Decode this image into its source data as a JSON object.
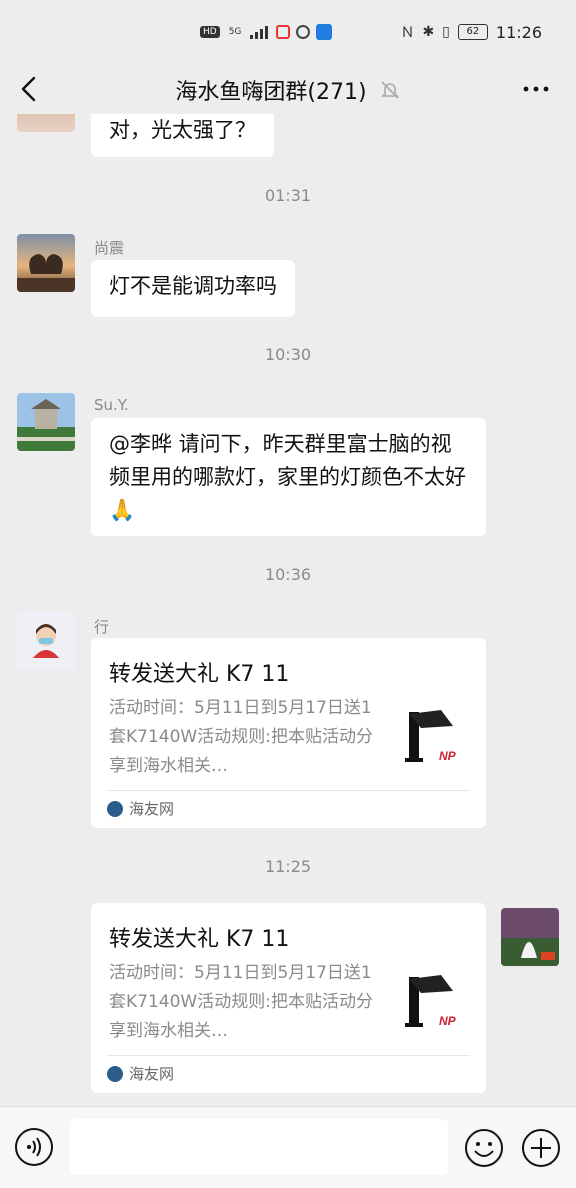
{
  "status_bar": {
    "left_chip": "HD",
    "network": "5G",
    "battery": "62",
    "time": "11:26",
    "icons": [
      "nfc-icon",
      "bluetooth-icon",
      "vibrate-icon"
    ]
  },
  "header": {
    "title": "海水鱼嗨团群(271)"
  },
  "messages": {
    "m0": {
      "text": "对，光太强了？"
    },
    "t1": "01:31",
    "m1": {
      "sender": "尚震",
      "text": "灯不是能调功率吗"
    },
    "t2": "10:30",
    "m2": {
      "sender": "Su.Y.",
      "text": "@李晔  请问下，昨天群里富士脑的视频里用的哪款灯，家里的灯颜色不太好🙏"
    },
    "t3": "10:36",
    "m3": {
      "sender": "行",
      "card": {
        "title": "转发送大礼 K7 11",
        "desc": "活动时间：5月11日到5月17日送1套K7140W活动规则:把本贴活动分享到海水相关…",
        "source": "海友网"
      }
    },
    "t4": "11:25",
    "m4": {
      "card": {
        "title": "转发送大礼 K7 11",
        "desc": "活动时间：5月11日到5月17日送1套K7140W活动规则:把本贴活动分享到海水相关…",
        "source": "海友网"
      }
    }
  },
  "input": {
    "placeholder": ""
  },
  "colors": {
    "background": "#ededed",
    "bubble": "#ffffff",
    "card_source_icon": "#2a5d8a"
  }
}
